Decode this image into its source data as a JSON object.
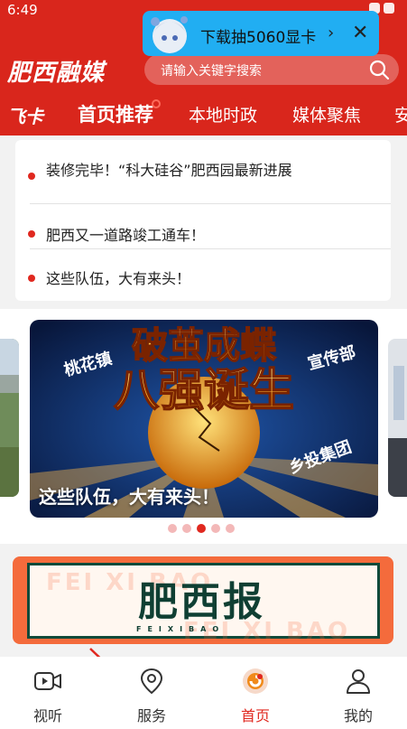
{
  "status_bar": {
    "time": "6:49"
  },
  "header": {
    "logo": "肥西融媒",
    "search_placeholder": "请输入关键字搜索"
  },
  "promo": {
    "text": "下载抽5060显卡",
    "chevron": "›",
    "close": "✕"
  },
  "tabs": [
    {
      "label": "飞卡"
    },
    {
      "label": "首页推荐"
    },
    {
      "label": "本地时政"
    },
    {
      "label": "媒体聚焦"
    },
    {
      "label": "安"
    }
  ],
  "news": [
    {
      "text": "装修完毕！“科大硅谷”肥西园最新进展"
    },
    {
      "text": "肥西又一道路竣工通车！"
    },
    {
      "text": "这些队伍，大有来头！"
    }
  ],
  "carousel": {
    "caption": "这些队伍，大有来头！",
    "slide_count": 5,
    "active_index": 2
  },
  "paper_banner": {
    "title": "肥西报",
    "subtitle": "FEIXIBAO",
    "watermark": "FEI XI BAO"
  },
  "bottom_nav": [
    {
      "label": "视听",
      "icon": "video-icon"
    },
    {
      "label": "服务",
      "icon": "location-icon"
    },
    {
      "label": "首页",
      "icon": "home-logo-icon"
    },
    {
      "label": "我的",
      "icon": "user-icon"
    }
  ],
  "colors": {
    "brand_red": "#d9261c",
    "promo_blue": "#21aef2",
    "active_red": "#e0281f"
  }
}
